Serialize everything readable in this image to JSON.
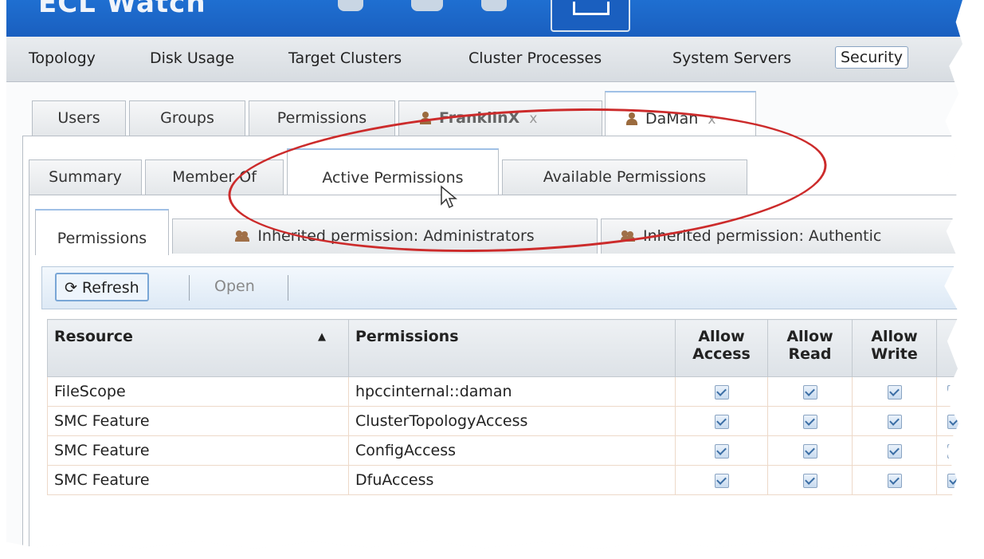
{
  "app": {
    "title": "ECL Watch"
  },
  "menu": [
    "Topology",
    "Disk Usage",
    "Target Clusters",
    "Cluster Processes",
    "System Servers",
    "Security"
  ],
  "tabs_level1": [
    {
      "label": "Users"
    },
    {
      "label": "Groups"
    },
    {
      "label": "Permissions"
    },
    {
      "label": "FranklinX",
      "close": "x"
    },
    {
      "label": "DaMan",
      "close": "x"
    }
  ],
  "tabs_level2": [
    "Summary",
    "Member Of",
    "Active Permissions",
    "Available Permissions"
  ],
  "tabs_level3": [
    "Permissions",
    "Inherited permission: Administrators",
    "Inherited permission: Authentic"
  ],
  "toolbar": {
    "refresh": "Refresh",
    "open": "Open"
  },
  "grid": {
    "columns": [
      "Resource",
      "Permissions",
      "Allow Access",
      "Allow Read",
      "Allow Write"
    ],
    "rows": [
      {
        "resource": "FileScope",
        "permissions": "hpccinternal::daman"
      },
      {
        "resource": "SMC Feature",
        "permissions": "ClusterTopologyAccess"
      },
      {
        "resource": "SMC Feature",
        "permissions": "ConfigAccess"
      },
      {
        "resource": "SMC Feature",
        "permissions": "DfuAccess"
      }
    ]
  },
  "colors": {
    "titlebar": "#1a5fbf",
    "highlight": "#cc2b2b"
  }
}
